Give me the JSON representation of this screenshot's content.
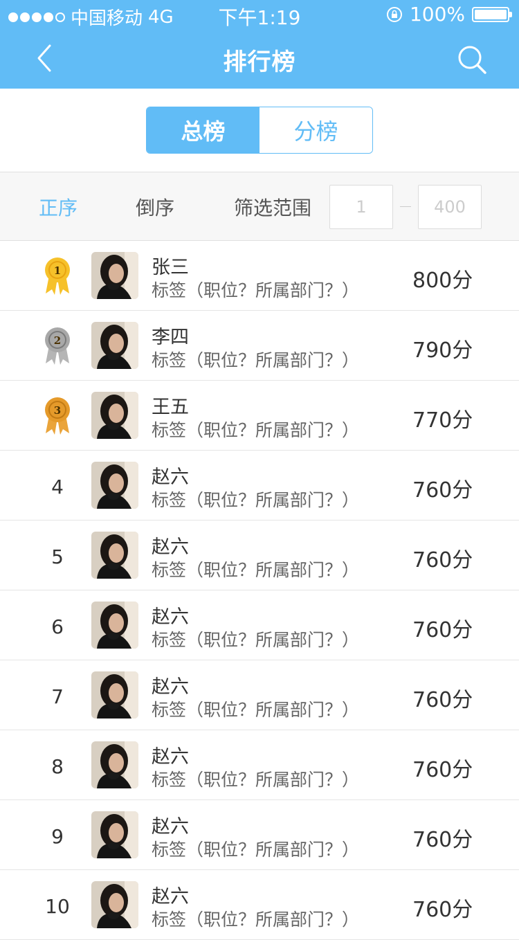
{
  "status_bar": {
    "carrier": "中国移动",
    "network": "4G",
    "time": "下午1:19",
    "battery": "100%"
  },
  "nav": {
    "title": "排行榜"
  },
  "tabs": [
    {
      "label": "总榜",
      "active": true
    },
    {
      "label": "分榜",
      "active": false
    }
  ],
  "filter": {
    "asc_label": "正序",
    "desc_label": "倒序",
    "range_label": "筛选范围",
    "range_from_placeholder": "1",
    "range_to_placeholder": "400"
  },
  "colors": {
    "accent": "#61bcf6",
    "gold": "#f2b51c",
    "silver": "#9b9b9b",
    "bronze": "#d98d1a"
  },
  "rows": [
    {
      "rank": "1",
      "medal": "gold-medal-icon",
      "name": "张三",
      "tag": "标签（职位？所属部门？）",
      "score": "800分"
    },
    {
      "rank": "2",
      "medal": "silver-medal-icon",
      "name": "李四",
      "tag": "标签（职位？所属部门？）",
      "score": "790分"
    },
    {
      "rank": "3",
      "medal": "bronze-medal-icon",
      "name": "王五",
      "tag": "标签（职位？所属部门？）",
      "score": "770分"
    },
    {
      "rank": "4",
      "name": "赵六",
      "tag": "标签（职位？所属部门？）",
      "score": "760分"
    },
    {
      "rank": "5",
      "name": "赵六",
      "tag": "标签（职位？所属部门？）",
      "score": "760分"
    },
    {
      "rank": "6",
      "name": "赵六",
      "tag": "标签（职位？所属部门？）",
      "score": "760分"
    },
    {
      "rank": "7",
      "name": "赵六",
      "tag": "标签（职位？所属部门？）",
      "score": "760分"
    },
    {
      "rank": "8",
      "name": "赵六",
      "tag": "标签（职位？所属部门？）",
      "score": "760分"
    },
    {
      "rank": "9",
      "name": "赵六",
      "tag": "标签（职位？所属部门？）",
      "score": "760分"
    },
    {
      "rank": "10",
      "name": "赵六",
      "tag": "标签（职位？所属部门？）",
      "score": "760分"
    }
  ]
}
